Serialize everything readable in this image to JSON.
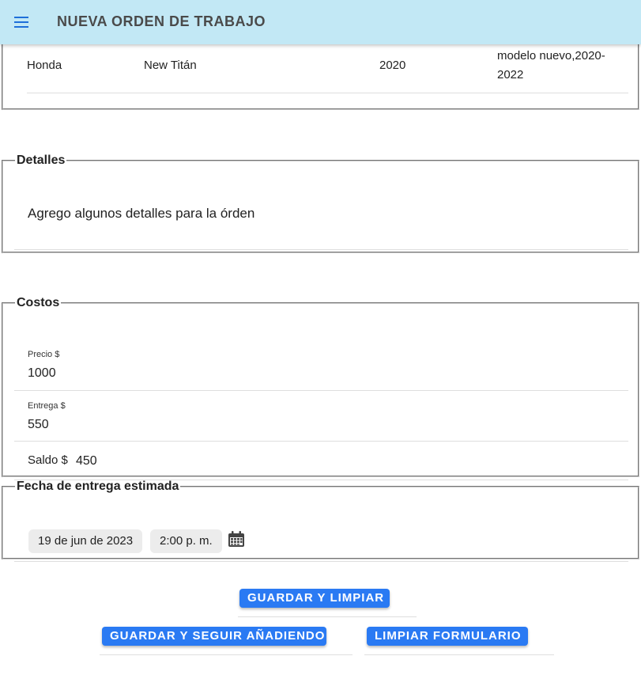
{
  "appbar": {
    "title": "NUEVA ORDEN DE TRABAJO",
    "menu_icon": "menu-icon",
    "bg_color": "#c2e8f5",
    "icon_color": "#1e6fd9"
  },
  "vehicle": {
    "row": {
      "marca": "Honda",
      "modelo": "New Titán",
      "anio": "2020",
      "detalle_line1": "modelo nuevo,2020-",
      "detalle_line2": "2022"
    }
  },
  "detalles": {
    "legend": "Detalles",
    "text": "Agrego algunos detalles para la órden"
  },
  "costos": {
    "legend": "Costos",
    "precio_label": "Precio $",
    "precio_value": "1000",
    "entrega_label": "Entrega $",
    "entrega_value": "550",
    "saldo_label": "Saldo $",
    "saldo_value": "450"
  },
  "fecha": {
    "legend": "Fecha de entrega estimada",
    "date": "19 de jun de 2023",
    "time": "2:00 p. m.",
    "calendar_icon": "calendar-icon"
  },
  "actions": {
    "save_clear": "GUARDAR Y LIMPIAR",
    "save_continue": "GUARDAR Y SEGUIR AÑADIENDO",
    "clear_form": "LIMPIAR FORMULARIO",
    "button_color": "#2a7af3"
  }
}
